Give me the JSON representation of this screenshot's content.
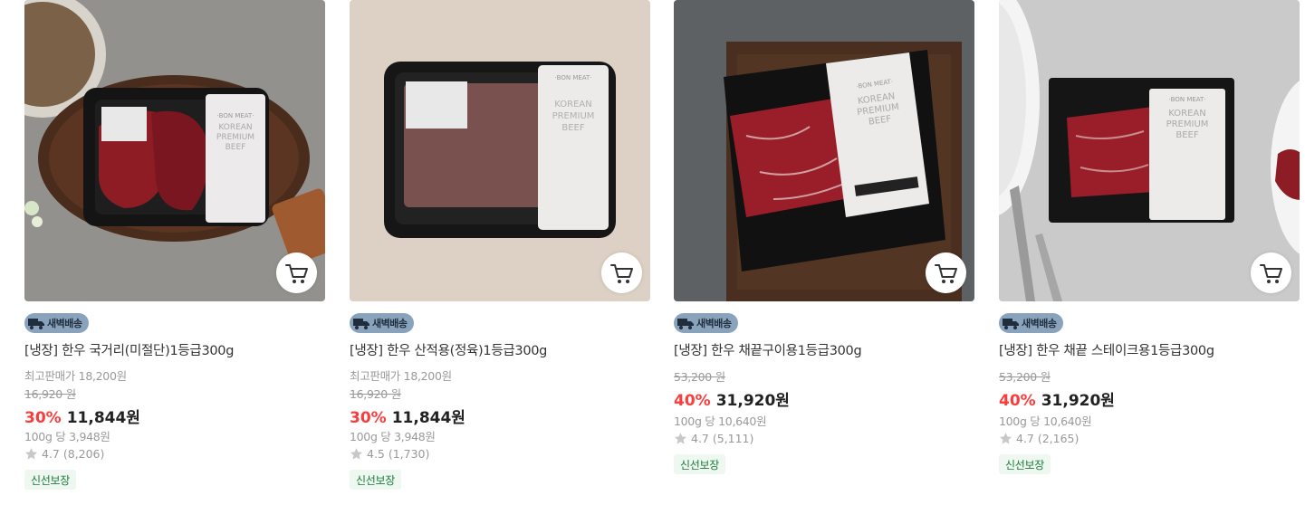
{
  "icons": {
    "cart": "cart-icon",
    "truck": "truck-icon",
    "star": "star-icon"
  },
  "colors": {
    "discount": "#fa3c3c",
    "badge_bg": "#8aa3bd",
    "fresh_bg": "#eef8f0",
    "fresh_text": "#1a7a3a",
    "star": "#c8c8c8"
  },
  "products": [
    {
      "badge": "새벽배송",
      "name": "[냉장] 한우 국거리(미절단)1등급300g",
      "top_price_label": "최고판매가 18,200원",
      "original_price": "16,920 원",
      "discount": "30%",
      "price": "11,844원",
      "unit_price": "100g 당 3,948원",
      "rating": "4.7 (8,206)",
      "tag": "신선보장"
    },
    {
      "badge": "새벽배송",
      "name": "[냉장] 한우 산적용(정육)1등급300g",
      "top_price_label": "최고판매가 18,200원",
      "original_price": "16,920 원",
      "discount": "30%",
      "price": "11,844원",
      "unit_price": "100g 당 3,948원",
      "rating": "4.5 (1,730)",
      "tag": "신선보장"
    },
    {
      "badge": "새벽배송",
      "name": "[냉장] 한우 채끝구이용1등급300g",
      "original_price": "53,200 원",
      "discount": "40%",
      "price": "31,920원",
      "unit_price": "100g 당 10,640원",
      "rating": "4.7 (5,111)",
      "tag": "신선보장"
    },
    {
      "badge": "새벽배송",
      "name": "[냉장] 한우 채끝 스테이크용1등급300g",
      "original_price": "53,200 원",
      "discount": "40%",
      "price": "31,920원",
      "unit_price": "100g 당 10,640원",
      "rating": "4.7 (2,165)",
      "tag": "신선보장"
    }
  ],
  "label_art": {
    "brand": "·BON MEAT·",
    "line1": "KOREAN",
    "line2": "PREMIUM",
    "line3": "BEEF"
  }
}
